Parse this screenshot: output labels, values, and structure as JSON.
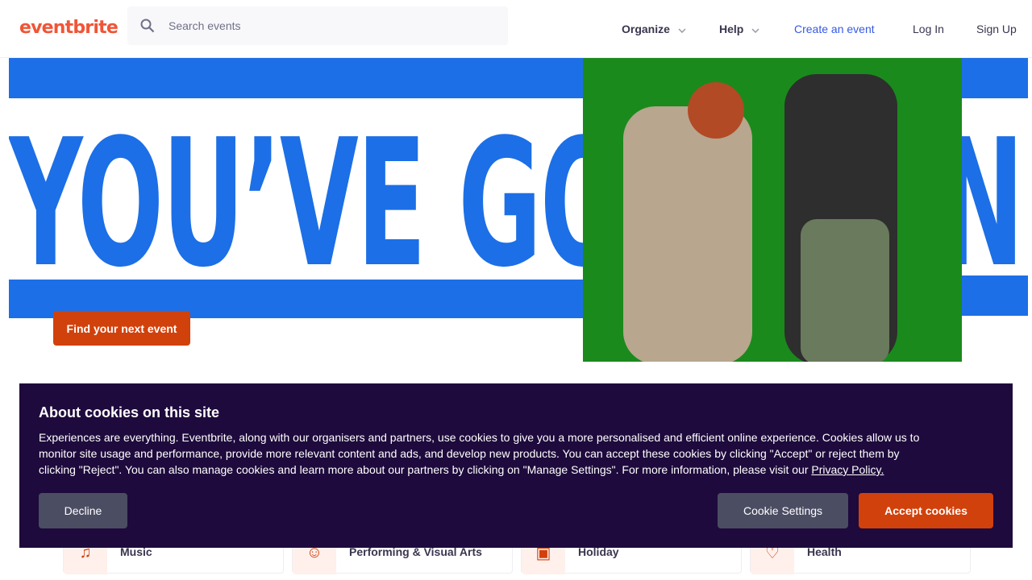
{
  "header": {
    "logo": "eventbrite",
    "search_placeholder": "Search events",
    "nav": {
      "organize": "Organize",
      "help": "Help",
      "create": "Create an event",
      "login": "Log In",
      "signup": "Sign Up"
    }
  },
  "hero": {
    "title": "YOU’VE GOT PLANS",
    "cta": "Find your next event",
    "colors": {
      "stripe": "#1c6fe6",
      "green": "#1a8a1c"
    }
  },
  "categories": [
    {
      "label": "Music",
      "icon": "music-icon"
    },
    {
      "label": "Performing & Visual Arts",
      "icon": "theater-mask-icon"
    },
    {
      "label": "Holiday",
      "icon": "holiday-icon"
    },
    {
      "label": "Health",
      "icon": "heart-icon"
    }
  ],
  "cookie_banner": {
    "title": "About cookies on this site",
    "body": "Experiences are everything. Eventbrite, along with our organisers and partners, use cookies to give you a more personalised and efficient online experience. Cookies allow us to monitor site usage and performance, provide more relevant content and ads, and develop new products. You can accept these cookies by clicking \"Accept\" or reject them by clicking \"Reject\". You can also manage cookies and learn more about our partners by clicking on \"Manage Settings\". For more information, please visit our ",
    "privacy_link": "Privacy Policy.",
    "decline": "Decline",
    "settings": "Cookie Settings",
    "accept": "Accept cookies"
  }
}
